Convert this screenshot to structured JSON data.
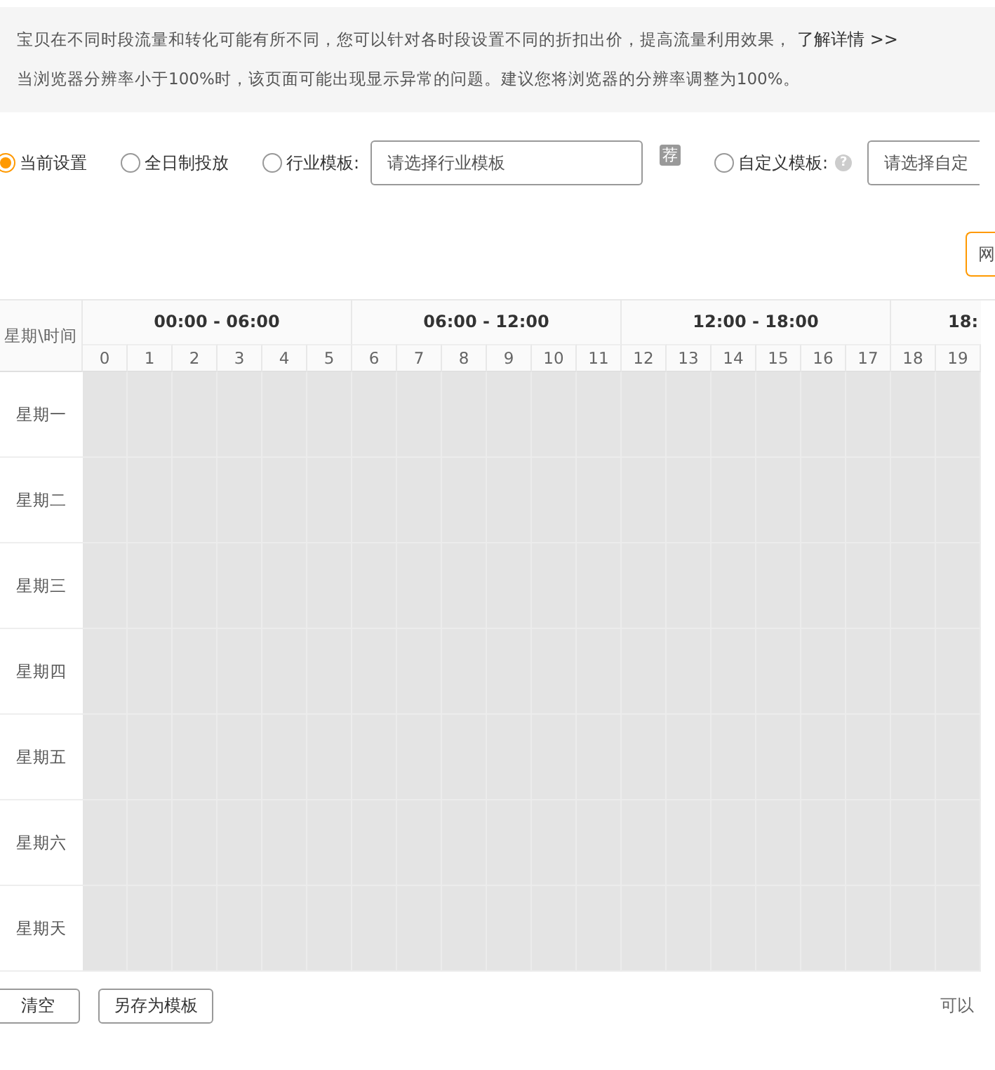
{
  "notice": {
    "lines": [
      {
        "text": "宝贝在不同时段流量和转化可能有所不同，您可以针对各时段设置不同的折扣出价，提高流量利用效果，",
        "link": "了解详情 >>"
      },
      {
        "text": "当浏览器分辨率小于100%时，该页面可能出现显示异常的问题。建议您将浏览器的分辨率调整为100%。"
      }
    ]
  },
  "options": [
    {
      "label": "当前设置",
      "selected": true
    },
    {
      "label": "全日制投放",
      "selected": false
    },
    {
      "label": "行业模板:",
      "selected": false,
      "placeholder": "请选择行业模板",
      "badge": "荐"
    },
    {
      "label": "自定义模板:",
      "selected": false,
      "help": "?",
      "placeholder": "请选择自定"
    }
  ],
  "toolbar_button": "网",
  "schedule": {
    "corner": "星期\\时间",
    "groups": [
      "00:00 - 06:00",
      "06:00 - 12:00",
      "12:00 - 18:00",
      "18:"
    ],
    "hours": [
      "0",
      "1",
      "2",
      "3",
      "4",
      "5",
      "6",
      "7",
      "8",
      "9",
      "10",
      "11",
      "12",
      "13",
      "14",
      "15",
      "16",
      "17",
      "18",
      "19"
    ],
    "days": [
      "星期一",
      "星期二",
      "星期三",
      "星期四",
      "星期五",
      "星期六",
      "星期天"
    ]
  },
  "footer": {
    "buttons": [
      "清空",
      "另存为模板"
    ],
    "hint": "可以"
  }
}
